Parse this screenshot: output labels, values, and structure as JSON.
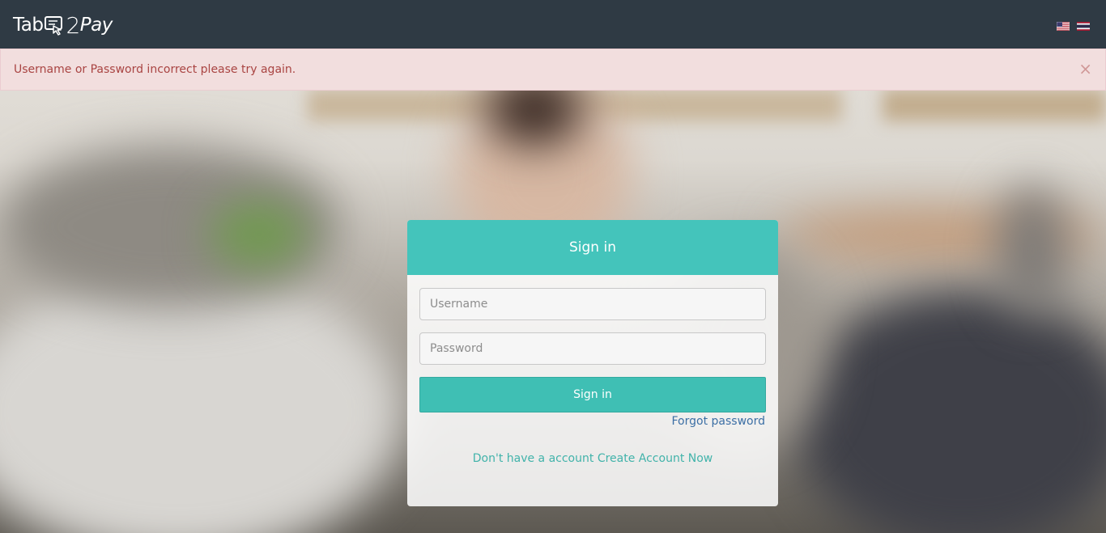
{
  "brand": {
    "logo_text_left": "Tab",
    "logo_text_two": "2",
    "logo_text_right": "Pay"
  },
  "navbar": {
    "background": "#2f3a44",
    "languages": [
      {
        "code": "en",
        "icon": "us-flag-icon"
      },
      {
        "code": "th",
        "icon": "thai-flag-icon"
      }
    ]
  },
  "alert": {
    "message": "Username or Password incorrect please try again.",
    "close_symbol": "×",
    "background": "#f2dede",
    "text_color": "#a94442"
  },
  "signin": {
    "title": "Sign in",
    "username_placeholder": "Username",
    "username_value": "",
    "password_placeholder": "Password",
    "password_value": "",
    "button_label": "Sign in",
    "forgot_label": "Forgot password",
    "no_account_text": "Don't have a account",
    "create_account_label": "Create Account Now",
    "accent_color": "#44c4bb"
  }
}
